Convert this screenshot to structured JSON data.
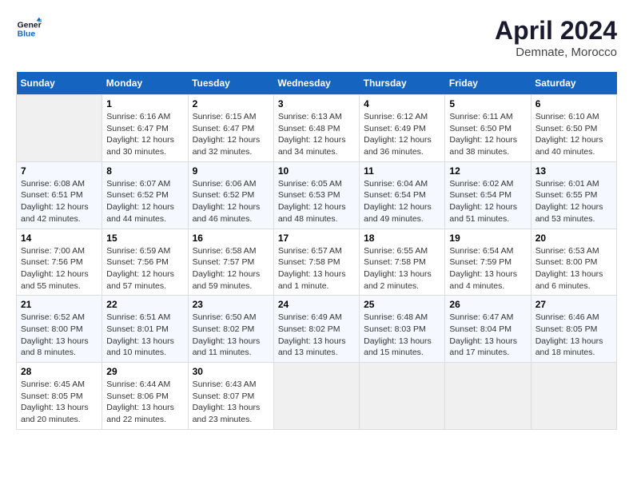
{
  "header": {
    "logo_line1": "General",
    "logo_line2": "Blue",
    "month": "April 2024",
    "location": "Demnate, Morocco"
  },
  "weekdays": [
    "Sunday",
    "Monday",
    "Tuesday",
    "Wednesday",
    "Thursday",
    "Friday",
    "Saturday"
  ],
  "weeks": [
    [
      {
        "day": "",
        "empty": true
      },
      {
        "day": "1",
        "sunrise": "Sunrise: 6:16 AM",
        "sunset": "Sunset: 6:47 PM",
        "daylight": "Daylight: 12 hours and 30 minutes."
      },
      {
        "day": "2",
        "sunrise": "Sunrise: 6:15 AM",
        "sunset": "Sunset: 6:47 PM",
        "daylight": "Daylight: 12 hours and 32 minutes."
      },
      {
        "day": "3",
        "sunrise": "Sunrise: 6:13 AM",
        "sunset": "Sunset: 6:48 PM",
        "daylight": "Daylight: 12 hours and 34 minutes."
      },
      {
        "day": "4",
        "sunrise": "Sunrise: 6:12 AM",
        "sunset": "Sunset: 6:49 PM",
        "daylight": "Daylight: 12 hours and 36 minutes."
      },
      {
        "day": "5",
        "sunrise": "Sunrise: 6:11 AM",
        "sunset": "Sunset: 6:50 PM",
        "daylight": "Daylight: 12 hours and 38 minutes."
      },
      {
        "day": "6",
        "sunrise": "Sunrise: 6:10 AM",
        "sunset": "Sunset: 6:50 PM",
        "daylight": "Daylight: 12 hours and 40 minutes."
      }
    ],
    [
      {
        "day": "7",
        "sunrise": "Sunrise: 6:08 AM",
        "sunset": "Sunset: 6:51 PM",
        "daylight": "Daylight: 12 hours and 42 minutes."
      },
      {
        "day": "8",
        "sunrise": "Sunrise: 6:07 AM",
        "sunset": "Sunset: 6:52 PM",
        "daylight": "Daylight: 12 hours and 44 minutes."
      },
      {
        "day": "9",
        "sunrise": "Sunrise: 6:06 AM",
        "sunset": "Sunset: 6:52 PM",
        "daylight": "Daylight: 12 hours and 46 minutes."
      },
      {
        "day": "10",
        "sunrise": "Sunrise: 6:05 AM",
        "sunset": "Sunset: 6:53 PM",
        "daylight": "Daylight: 12 hours and 48 minutes."
      },
      {
        "day": "11",
        "sunrise": "Sunrise: 6:04 AM",
        "sunset": "Sunset: 6:54 PM",
        "daylight": "Daylight: 12 hours and 49 minutes."
      },
      {
        "day": "12",
        "sunrise": "Sunrise: 6:02 AM",
        "sunset": "Sunset: 6:54 PM",
        "daylight": "Daylight: 12 hours and 51 minutes."
      },
      {
        "day": "13",
        "sunrise": "Sunrise: 6:01 AM",
        "sunset": "Sunset: 6:55 PM",
        "daylight": "Daylight: 12 hours and 53 minutes."
      }
    ],
    [
      {
        "day": "14",
        "sunrise": "Sunrise: 7:00 AM",
        "sunset": "Sunset: 7:56 PM",
        "daylight": "Daylight: 12 hours and 55 minutes."
      },
      {
        "day": "15",
        "sunrise": "Sunrise: 6:59 AM",
        "sunset": "Sunset: 7:56 PM",
        "daylight": "Daylight: 12 hours and 57 minutes."
      },
      {
        "day": "16",
        "sunrise": "Sunrise: 6:58 AM",
        "sunset": "Sunset: 7:57 PM",
        "daylight": "Daylight: 12 hours and 59 minutes."
      },
      {
        "day": "17",
        "sunrise": "Sunrise: 6:57 AM",
        "sunset": "Sunset: 7:58 PM",
        "daylight": "Daylight: 13 hours and 1 minute."
      },
      {
        "day": "18",
        "sunrise": "Sunrise: 6:55 AM",
        "sunset": "Sunset: 7:58 PM",
        "daylight": "Daylight: 13 hours and 2 minutes."
      },
      {
        "day": "19",
        "sunrise": "Sunrise: 6:54 AM",
        "sunset": "Sunset: 7:59 PM",
        "daylight": "Daylight: 13 hours and 4 minutes."
      },
      {
        "day": "20",
        "sunrise": "Sunrise: 6:53 AM",
        "sunset": "Sunset: 8:00 PM",
        "daylight": "Daylight: 13 hours and 6 minutes."
      }
    ],
    [
      {
        "day": "21",
        "sunrise": "Sunrise: 6:52 AM",
        "sunset": "Sunset: 8:00 PM",
        "daylight": "Daylight: 13 hours and 8 minutes."
      },
      {
        "day": "22",
        "sunrise": "Sunrise: 6:51 AM",
        "sunset": "Sunset: 8:01 PM",
        "daylight": "Daylight: 13 hours and 10 minutes."
      },
      {
        "day": "23",
        "sunrise": "Sunrise: 6:50 AM",
        "sunset": "Sunset: 8:02 PM",
        "daylight": "Daylight: 13 hours and 11 minutes."
      },
      {
        "day": "24",
        "sunrise": "Sunrise: 6:49 AM",
        "sunset": "Sunset: 8:02 PM",
        "daylight": "Daylight: 13 hours and 13 minutes."
      },
      {
        "day": "25",
        "sunrise": "Sunrise: 6:48 AM",
        "sunset": "Sunset: 8:03 PM",
        "daylight": "Daylight: 13 hours and 15 minutes."
      },
      {
        "day": "26",
        "sunrise": "Sunrise: 6:47 AM",
        "sunset": "Sunset: 8:04 PM",
        "daylight": "Daylight: 13 hours and 17 minutes."
      },
      {
        "day": "27",
        "sunrise": "Sunrise: 6:46 AM",
        "sunset": "Sunset: 8:05 PM",
        "daylight": "Daylight: 13 hours and 18 minutes."
      }
    ],
    [
      {
        "day": "28",
        "sunrise": "Sunrise: 6:45 AM",
        "sunset": "Sunset: 8:05 PM",
        "daylight": "Daylight: 13 hours and 20 minutes."
      },
      {
        "day": "29",
        "sunrise": "Sunrise: 6:44 AM",
        "sunset": "Sunset: 8:06 PM",
        "daylight": "Daylight: 13 hours and 22 minutes."
      },
      {
        "day": "30",
        "sunrise": "Sunrise: 6:43 AM",
        "sunset": "Sunset: 8:07 PM",
        "daylight": "Daylight: 13 hours and 23 minutes."
      },
      {
        "day": "",
        "empty": true
      },
      {
        "day": "",
        "empty": true
      },
      {
        "day": "",
        "empty": true
      },
      {
        "day": "",
        "empty": true
      }
    ]
  ]
}
